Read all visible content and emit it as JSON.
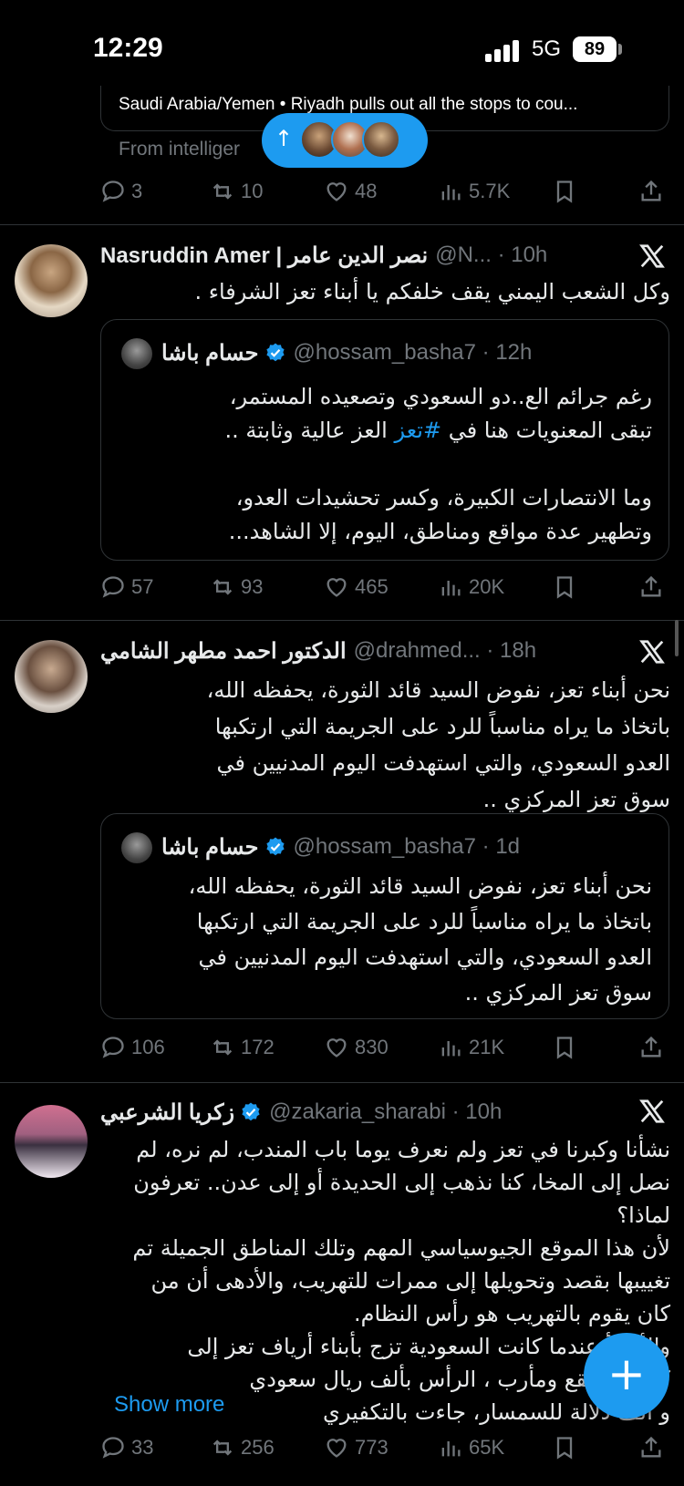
{
  "status_bar": {
    "time": "12:29",
    "network": "5G",
    "battery": "89"
  },
  "previous_tweet": {
    "card_caption": "Saudi Arabia/Yemen • Riyadh pulls out all the stops to cou...",
    "source": "From intelliger",
    "stats": {
      "replies": "3",
      "reposts": "10",
      "likes": "48",
      "views": "5.7K"
    }
  },
  "new_posts_pill": {
    "arrow": "↑"
  },
  "tweets": [
    {
      "name": "Nasruddin Amer | نصر الدين عامر",
      "handle": "@N... · 10h",
      "text": "وكل الشعب اليمني يقف خلفكم يا أبناء تعز الشرفاء .",
      "quote": {
        "name": "حسام باشا",
        "handle": "@hossam_basha7 · 12h",
        "line1": "رغم جرائم الع..دو السعودي وتصعيده المستمر،",
        "line2_before": "تبقى المعنويات هنا في ",
        "line2_hashtag": "#تعز",
        "line2_after": " العز عالية وثابتة ..",
        "line3": "وما الانتصارات الكبيرة، وكسر تحشيدات العدو،",
        "line4": "وتطهير عدة مواقع ومناطق، اليوم، إلا الشاهد..."
      },
      "stats": {
        "replies": "57",
        "reposts": "93",
        "likes": "465",
        "views": "20K"
      }
    },
    {
      "name": "الدكتور احمد مطهر الشامي",
      "handle": "@drahmed... · 18h",
      "lines": [
        "نحن أبناء تعز، نفوض السيد قائد الثورة، يحفظه الله،",
        "باتخاذ ما يراه مناسباً للرد على الجريمة التي ارتكبها",
        "العدو السعودي، والتي استهدفت اليوم المدنيين في",
        "سوق تعز المركزي .."
      ],
      "quote": {
        "name": "حسام باشا",
        "handle": "@hossam_basha7 · 1d",
        "lines": [
          "نحن أبناء تعز، نفوض السيد قائد الثورة، يحفظه الله،",
          "باتخاذ ما يراه مناسباً للرد على الجريمة التي ارتكبها",
          "العدو السعودي، والتي استهدفت اليوم المدنيين في",
          "سوق تعز المركزي .."
        ]
      },
      "stats": {
        "replies": "106",
        "reposts": "172",
        "likes": "830",
        "views": "21K"
      }
    },
    {
      "name": "زكريا الشرعبي",
      "handle": "@zakaria_sharabi · 10h",
      "lines": [
        "نشأنا وكبرنا في تعز ولم نعرف يوما باب المندب، لم نره، لم",
        "نصل إلى المخا، كنا نذهب إلى الحديدة أو إلى عدن.. تعرفون",
        "لماذا؟",
        "لأن هذا الموقع الجيوسياسي المهم وتلك المناطق الجميلة تم",
        "تغييبها بقصد وتحويلها إلى ممرات للتهريب، والأدهى أن من",
        "كان يقوم بالتهريب هو رأس النظام.",
        "والأسوأ عندما كانت السعودية تزج بأبناء أرياف تعز إلى",
        "كتاف والبقع ومأرب ، الرأس بألف ريال سعودي",
        "و ألف دلالة للسمسار، جاءت بالتكفيري"
      ],
      "show_more": "Show more",
      "stats": {
        "replies": "33",
        "reposts": "256",
        "likes": "773",
        "views": "65K"
      }
    }
  ],
  "fab": {
    "label": "+"
  },
  "colors": {
    "accent": "#1d9bf0",
    "background": "#000000",
    "muted": "#71767b",
    "border": "#2f3336"
  }
}
